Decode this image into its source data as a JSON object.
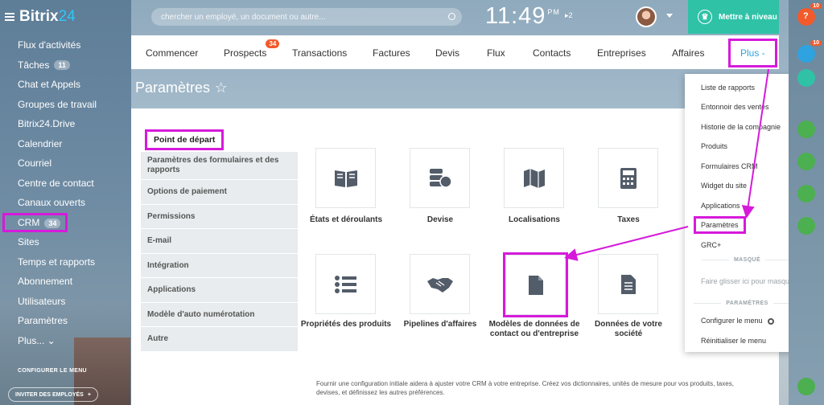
{
  "brand": {
    "name_a": "Bitrix",
    "name_b": "24"
  },
  "sidebar": {
    "items": [
      {
        "label": "Flux d'activités",
        "counter": ""
      },
      {
        "label": "Tâches",
        "counter": "11"
      },
      {
        "label": "Chat et Appels",
        "counter": ""
      },
      {
        "label": "Groupes de travail",
        "counter": ""
      },
      {
        "label": "Bitrix24.Drive",
        "counter": ""
      },
      {
        "label": "Calendrier",
        "counter": ""
      },
      {
        "label": "Courriel",
        "counter": ""
      },
      {
        "label": "Centre de contact",
        "counter": ""
      },
      {
        "label": "Canaux ouverts",
        "counter": ""
      },
      {
        "label": "CRM",
        "counter": "34"
      },
      {
        "label": "Sites",
        "counter": ""
      },
      {
        "label": "Temps et rapports",
        "counter": ""
      },
      {
        "label": "Abonnement",
        "counter": ""
      },
      {
        "label": "Utilisateurs",
        "counter": ""
      },
      {
        "label": "Paramètres",
        "counter": ""
      },
      {
        "label": "Plus... ⌄",
        "counter": ""
      }
    ],
    "config_menu": "CONFIGURER LE MENU",
    "invite": "INVITER DES EMPLOYÉS"
  },
  "header": {
    "search_placeholder": "chercher un employé, un document ou autre...",
    "time": "11:49",
    "ampm": "PM",
    "notif": "▸2",
    "upgrade": "Mettre à niveau"
  },
  "tabs": [
    {
      "label": "Commencer",
      "badge": ""
    },
    {
      "label": "Prospects",
      "badge": "34"
    },
    {
      "label": "Transactions",
      "badge": ""
    },
    {
      "label": "Factures",
      "badge": ""
    },
    {
      "label": "Devis",
      "badge": ""
    },
    {
      "label": "Flux",
      "badge": ""
    },
    {
      "label": "Contacts",
      "badge": ""
    },
    {
      "label": "Entreprises",
      "badge": ""
    },
    {
      "label": "Affaires",
      "badge": ""
    },
    {
      "label": "Plus -",
      "badge": ""
    }
  ],
  "page_title": "Paramètres",
  "title_star": "☆",
  "side_menu": [
    "Point de départ",
    "Paramètres des formulaires et des rapports",
    "Options de paiement",
    "Permissions",
    "E-mail",
    "Intégration",
    "Applications",
    "Modèle d'auto numérotation",
    "Autre"
  ],
  "tiles": [
    {
      "label": "États et déroulants",
      "icon": "book-icon"
    },
    {
      "label": "Devise",
      "icon": "coins-icon"
    },
    {
      "label": "Localisations",
      "icon": "map-icon"
    },
    {
      "label": "Taxes",
      "icon": "calculator-icon"
    },
    {
      "label": "Propriétés des produits",
      "icon": "list-icon"
    },
    {
      "label": "Pipelines d'affaires",
      "icon": "handshake-icon"
    },
    {
      "label": "Modèles de données de contact ou d'entreprise",
      "icon": "file-icon"
    },
    {
      "label": "Données de votre société",
      "icon": "document-icon"
    }
  ],
  "footer_note": "Fournir une configuration initiale aidera à ajuster votre CRM à votre entreprise. Créez vos dictionnaires, unités de mesure pour vos produits, taxes, devises, et définissez les autres préférences.",
  "dropdown": {
    "items": [
      "Liste de rapports",
      "Entonnoir des ventes",
      "Historie de la compagnie",
      "Produits",
      "Formulaires CRM",
      "Widget du site",
      "Applications",
      "Paramètres",
      "GRC+"
    ],
    "section_hidden": "MASQUÉ",
    "drag_hint": "Faire glisser ici pour masquer",
    "section_settings": "PARAMÈTRES",
    "configure": "Configurer le menu",
    "reset": "Réinitialiser le menu"
  },
  "rail": {
    "badge1": "10",
    "badge2": "10"
  },
  "colors": {
    "accent": "#2fa2e0",
    "highlight": "#d61adb",
    "upgrade": "#2fc2a7",
    "badge": "#f25a2b"
  }
}
